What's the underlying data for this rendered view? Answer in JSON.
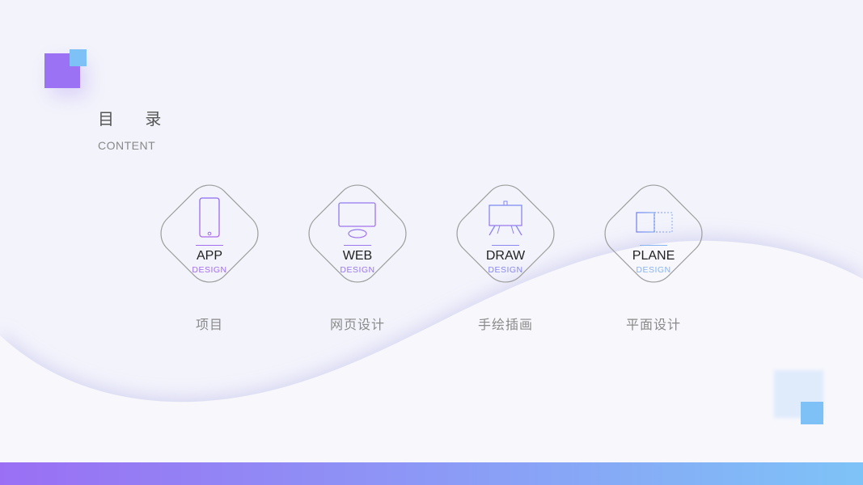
{
  "header": {
    "title": "目 录",
    "subtitle": "CONTENT"
  },
  "items": [
    {
      "title": "APP",
      "sub": "DESIGN",
      "label": "项目",
      "icon": "smartphone-icon",
      "accent": "#a46df0"
    },
    {
      "title": "WEB",
      "sub": "DESIGN",
      "label": "网页设计",
      "icon": "monitor-icon",
      "accent": "#9b77ee"
    },
    {
      "title": "DRAW",
      "sub": "DESIGN",
      "label": "手绘插画",
      "icon": "easel-icon",
      "accent": "#8a87ef"
    },
    {
      "title": "PLANE",
      "sub": "DESIGN",
      "label": "平面设计",
      "icon": "layout-icon",
      "accent": "#86b4f3"
    }
  ],
  "colors": {
    "purple": "#9a72f3",
    "blue": "#7ec1f7",
    "gradient_start": "#9a6ff4",
    "gradient_end": "#7ec3f7"
  }
}
